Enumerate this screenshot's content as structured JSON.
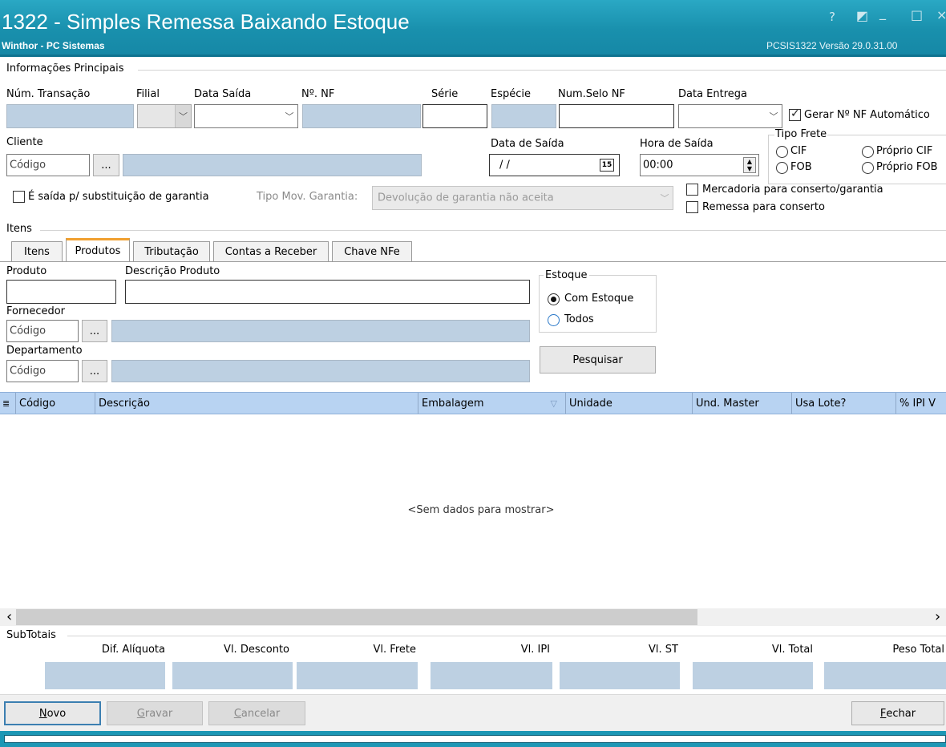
{
  "window": {
    "title": "1322 - Simples Remessa Baixando Estoque",
    "subtitle": "Winthor - PC Sistemas",
    "version": "PCSIS1322  Versão  29.0.31.00",
    "controls": [
      "?",
      "◩",
      "_",
      "□",
      "×"
    ]
  },
  "principal": {
    "group_label": "Informações Principais",
    "num_transacao_label": "Núm. Transação",
    "filial_label": "Filial",
    "data_saida_label": "Data Saída",
    "nf_label": "Nº. NF",
    "serie_label": "Série",
    "especie_label": "Espécie",
    "num_selo_label": "Num.Selo NF",
    "data_entrega_label": "Data Entrega",
    "gerar_nf_label": "Gerar Nº NF Automático",
    "gerar_nf_checked": true,
    "cliente_label": "Cliente",
    "cliente_codigo_placeholder": "Código",
    "ellipsis": "...",
    "data_de_saida_label": "Data de Saída",
    "data_de_saida_value": "/ /",
    "calendar_glyph": "15",
    "hora_saida_label": "Hora de Saída",
    "hora_saida_value": "00:00",
    "tipo_frete_label": "Tipo Frete",
    "frete_cif": "CIF",
    "frete_fob": "FOB",
    "frete_proprio_cif": "Próprio CIF",
    "frete_proprio_fob": "Próprio FOB",
    "saida_garantia_label": "É saída p/ substituição de garantia",
    "tipo_mov_label": "Tipo Mov. Garantia:",
    "tipo_mov_value": "Devolução de garantia não aceita",
    "mercadoria_conserto_label": "Mercadoria para conserto/garantia",
    "remessa_conserto_label": "Remessa para conserto"
  },
  "itens": {
    "group_label": "Itens",
    "tabs": [
      "Itens",
      "Produtos",
      "Tributação",
      "Contas a Receber",
      "Chave NFe"
    ],
    "active_tab": "Produtos",
    "produto_label": "Produto",
    "descricao_label": "Descrição Produto",
    "fornecedor_label": "Fornecedor",
    "departamento_label": "Departamento",
    "codigo_placeholder": "Código",
    "estoque_label": "Estoque",
    "com_estoque_label": "Com Estoque",
    "todos_label": "Todos",
    "pesquisar_label": "Pesquisar"
  },
  "grid": {
    "columns": [
      "Código",
      "Descrição",
      "Embalagem",
      "Unidade",
      "Und. Master",
      "Usa Lote?",
      "% IPI V"
    ],
    "empty_text": "<Sem dados para mostrar>",
    "scroll_left": "‹",
    "scroll_right": "›"
  },
  "subtotais": {
    "group_label": "SubTotais",
    "labels": [
      "Dif. Alíquota",
      "Vl. Desconto",
      "Vl. Frete",
      "Vl. IPI",
      "Vl. ST",
      "Vl. Total",
      "Peso Total"
    ]
  },
  "footer": {
    "novo_rest": "ovo",
    "novo_key": "N",
    "gravar_key": "G",
    "gravar_rest": "ravar",
    "cancelar_key": "C",
    "cancelar_rest": "ancelar",
    "fechar_key": "F",
    "fechar_rest": "echar"
  },
  "colors": {
    "title_bar": "#1f9bb8",
    "readonly_field": "#bdd0e2",
    "grid_header": "#b8d3f2"
  }
}
